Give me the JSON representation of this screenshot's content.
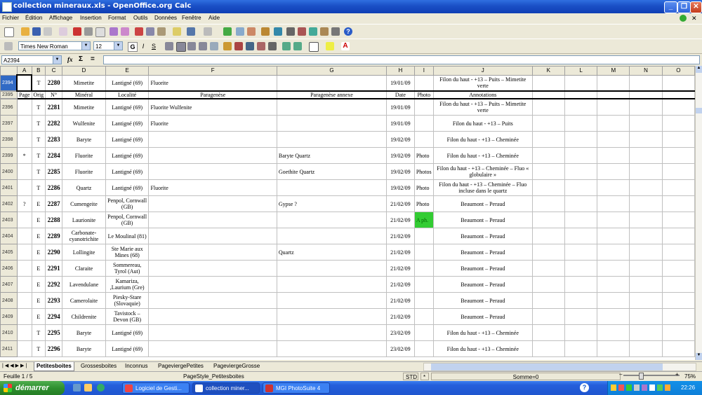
{
  "window": {
    "title": "collection mineraux.xls - OpenOffice.org Calc"
  },
  "menu": [
    "Fichier",
    "Édition",
    "Affichage",
    "Insertion",
    "Format",
    "Outils",
    "Données",
    "Fenêtre",
    "Aide"
  ],
  "format_toolbar": {
    "font": "Times New Roman",
    "size": "12",
    "bold": "G",
    "italic": "I",
    "underline": "S"
  },
  "formula_bar": {
    "cell_ref": "A2394",
    "fx": "fx",
    "sigma": "Σ",
    "equals": "=",
    "content": ""
  },
  "columns": [
    "A",
    "B",
    "C",
    "D",
    "E",
    "F",
    "G",
    "H",
    "I",
    "J",
    "K",
    "L",
    "M",
    "N",
    "O"
  ],
  "rows": [
    {
      "n": "2394",
      "a": "",
      "b": "T",
      "c": "2280",
      "d": "Mimetite",
      "e": "Lantigné (69)",
      "f": "Fluorite",
      "g": "",
      "h": "19/01/09",
      "i": "",
      "j": "Filon du haut - +13 – Puits – Mimetite verte"
    },
    {
      "n": "2395",
      "a": "Page",
      "b": "Orig",
      "c": "N°",
      "d": "Minéral",
      "e": "Localité",
      "f": "Paragenèse",
      "g": "Paragenèse annexe",
      "h": "Date",
      "i": "Photo",
      "j": "Annotations"
    },
    {
      "n": "2396",
      "a": "",
      "b": "T",
      "c": "2281",
      "d": "Mimetite",
      "e": "Lantigné (69)",
      "f": "Fluorite Wulfenite",
      "g": "",
      "h": "19/01/09",
      "i": "",
      "j": "Filon du haut - +13 – Puits – Mimetite verte"
    },
    {
      "n": "2397",
      "a": "",
      "b": "T",
      "c": "2282",
      "d": "Wulfenite",
      "e": "Lantigné (69)",
      "f": "Fluorite",
      "g": "",
      "h": "19/01/09",
      "i": "",
      "j": "Filon du haut - +13 – Puits"
    },
    {
      "n": "2398",
      "a": "",
      "b": "T",
      "c": "2283",
      "d": "Baryte",
      "e": "Lantigné (69)",
      "f": "",
      "g": "",
      "h": "19/02/09",
      "i": "",
      "j": "Filon du haut - +13 – Cheminée"
    },
    {
      "n": "2399",
      "a": "*",
      "b": "T",
      "c": "2284",
      "d": "Fluorite",
      "e": "Lantigné (69)",
      "f": "",
      "g": "Baryte Quartz",
      "h": "19/02/09",
      "i": "Photo",
      "j": "Filon du haut - +13 – Cheminée"
    },
    {
      "n": "2400",
      "a": "",
      "b": "T",
      "c": "2285",
      "d": "Fluorite",
      "e": "Lantigné (69)",
      "f": "",
      "g": "Goethite Quartz",
      "h": "19/02/09",
      "i": "Photos",
      "j": "Filon du haut - +13 – Cheminée – Fluo « globulaire »"
    },
    {
      "n": "2401",
      "a": "",
      "b": "T",
      "c": "2286",
      "d": "Quartz",
      "e": "Lantigné (69)",
      "f": "Fluorite",
      "g": "",
      "h": "19/02/09",
      "i": "Photo",
      "j": "Filon du haut - +13 – Cheminée – Fluo incluse dans le quartz"
    },
    {
      "n": "2402",
      "a": "?",
      "b": "E",
      "c": "2287",
      "d": "Cumengeite",
      "e": "Penpol, Cornwall (GB)",
      "f": "",
      "g": "Gypse ?",
      "h": "21/02/09",
      "i": "Photo",
      "j": "Beaumont – Peraud"
    },
    {
      "n": "2403",
      "a": "",
      "b": "E",
      "c": "2288",
      "d": "Laurionite",
      "e": "Penpol, Cornwall (GB)",
      "f": "",
      "g": "",
      "h": "21/02/09",
      "i": "A ph.",
      "j": "Beaumont – Peraud",
      "green": true
    },
    {
      "n": "2404",
      "a": "",
      "b": "E",
      "c": "2289",
      "d": "Carbonate-cyanotrichite",
      "e": "Le Moulinal (81)",
      "f": "",
      "g": "",
      "h": "21/02/09",
      "i": "",
      "j": "Beaumont – Peraud"
    },
    {
      "n": "2405",
      "a": "",
      "b": "E",
      "c": "2290",
      "d": "Lollingite",
      "e": "Ste Marie aux Mines (68)",
      "f": "",
      "g": "Quartz",
      "h": "21/02/09",
      "i": "",
      "j": "Beaumont – Peraud"
    },
    {
      "n": "2406",
      "a": "",
      "b": "E",
      "c": "2291",
      "d": "Claraite",
      "e": "Sommereau, Tyrol (Aut)",
      "f": "",
      "g": "",
      "h": "21/02/09",
      "i": "",
      "j": "Beaumont – Peraud"
    },
    {
      "n": "2407",
      "a": "",
      "b": "E",
      "c": "2292",
      "d": "Lavendulane",
      "e": "Kamariza, ,Laurium (Gre)",
      "f": "",
      "g": "",
      "h": "21/02/09",
      "i": "",
      "j": "Beaumont – Peraud"
    },
    {
      "n": "2408",
      "a": "",
      "b": "E",
      "c": "2293",
      "d": "Camerolaite",
      "e": "Piesky-Stare (Slovaquie)",
      "f": "",
      "g": "",
      "h": "21/02/09",
      "i": "",
      "j": "Beaumont – Peraud"
    },
    {
      "n": "2409",
      "a": "",
      "b": "E",
      "c": "2294",
      "d": "Childrenite",
      "e": "Tavistock – Devon (GB)",
      "f": "",
      "g": "",
      "h": "21/02/09",
      "i": "",
      "j": "Beaumont – Peraud"
    },
    {
      "n": "2410",
      "a": "",
      "b": "T",
      "c": "2295",
      "d": "Baryte",
      "e": "Lantigné (69)",
      "f": "",
      "g": "",
      "h": "23/02/09",
      "i": "",
      "j": "Filon du haut - +13 – Cheminée"
    },
    {
      "n": "2411",
      "a": "",
      "b": "T",
      "c": "2296",
      "d": "Baryte",
      "e": "Lantigné (69)",
      "f": "",
      "g": "",
      "h": "23/02/09",
      "i": "",
      "j": "Filon du haut - +13 – Cheminée"
    }
  ],
  "sheet_tabs": [
    "Petitesboites",
    "Grossesboites",
    "Inconnus",
    "PageviergePetites",
    "PageviergeGrosse"
  ],
  "status": {
    "sheet": "Feuille 1 / 5",
    "style": "PageStyle_Petitesboites",
    "mode": "STD",
    "star": "*",
    "sum": "Somme=0",
    "zoom": "75%"
  },
  "taskbar": {
    "start": "démarrer",
    "tasks": [
      "Logiciel de Gesti...",
      "collection miner...",
      "MGI PhotoSuite 4"
    ],
    "clock": "22:26"
  }
}
